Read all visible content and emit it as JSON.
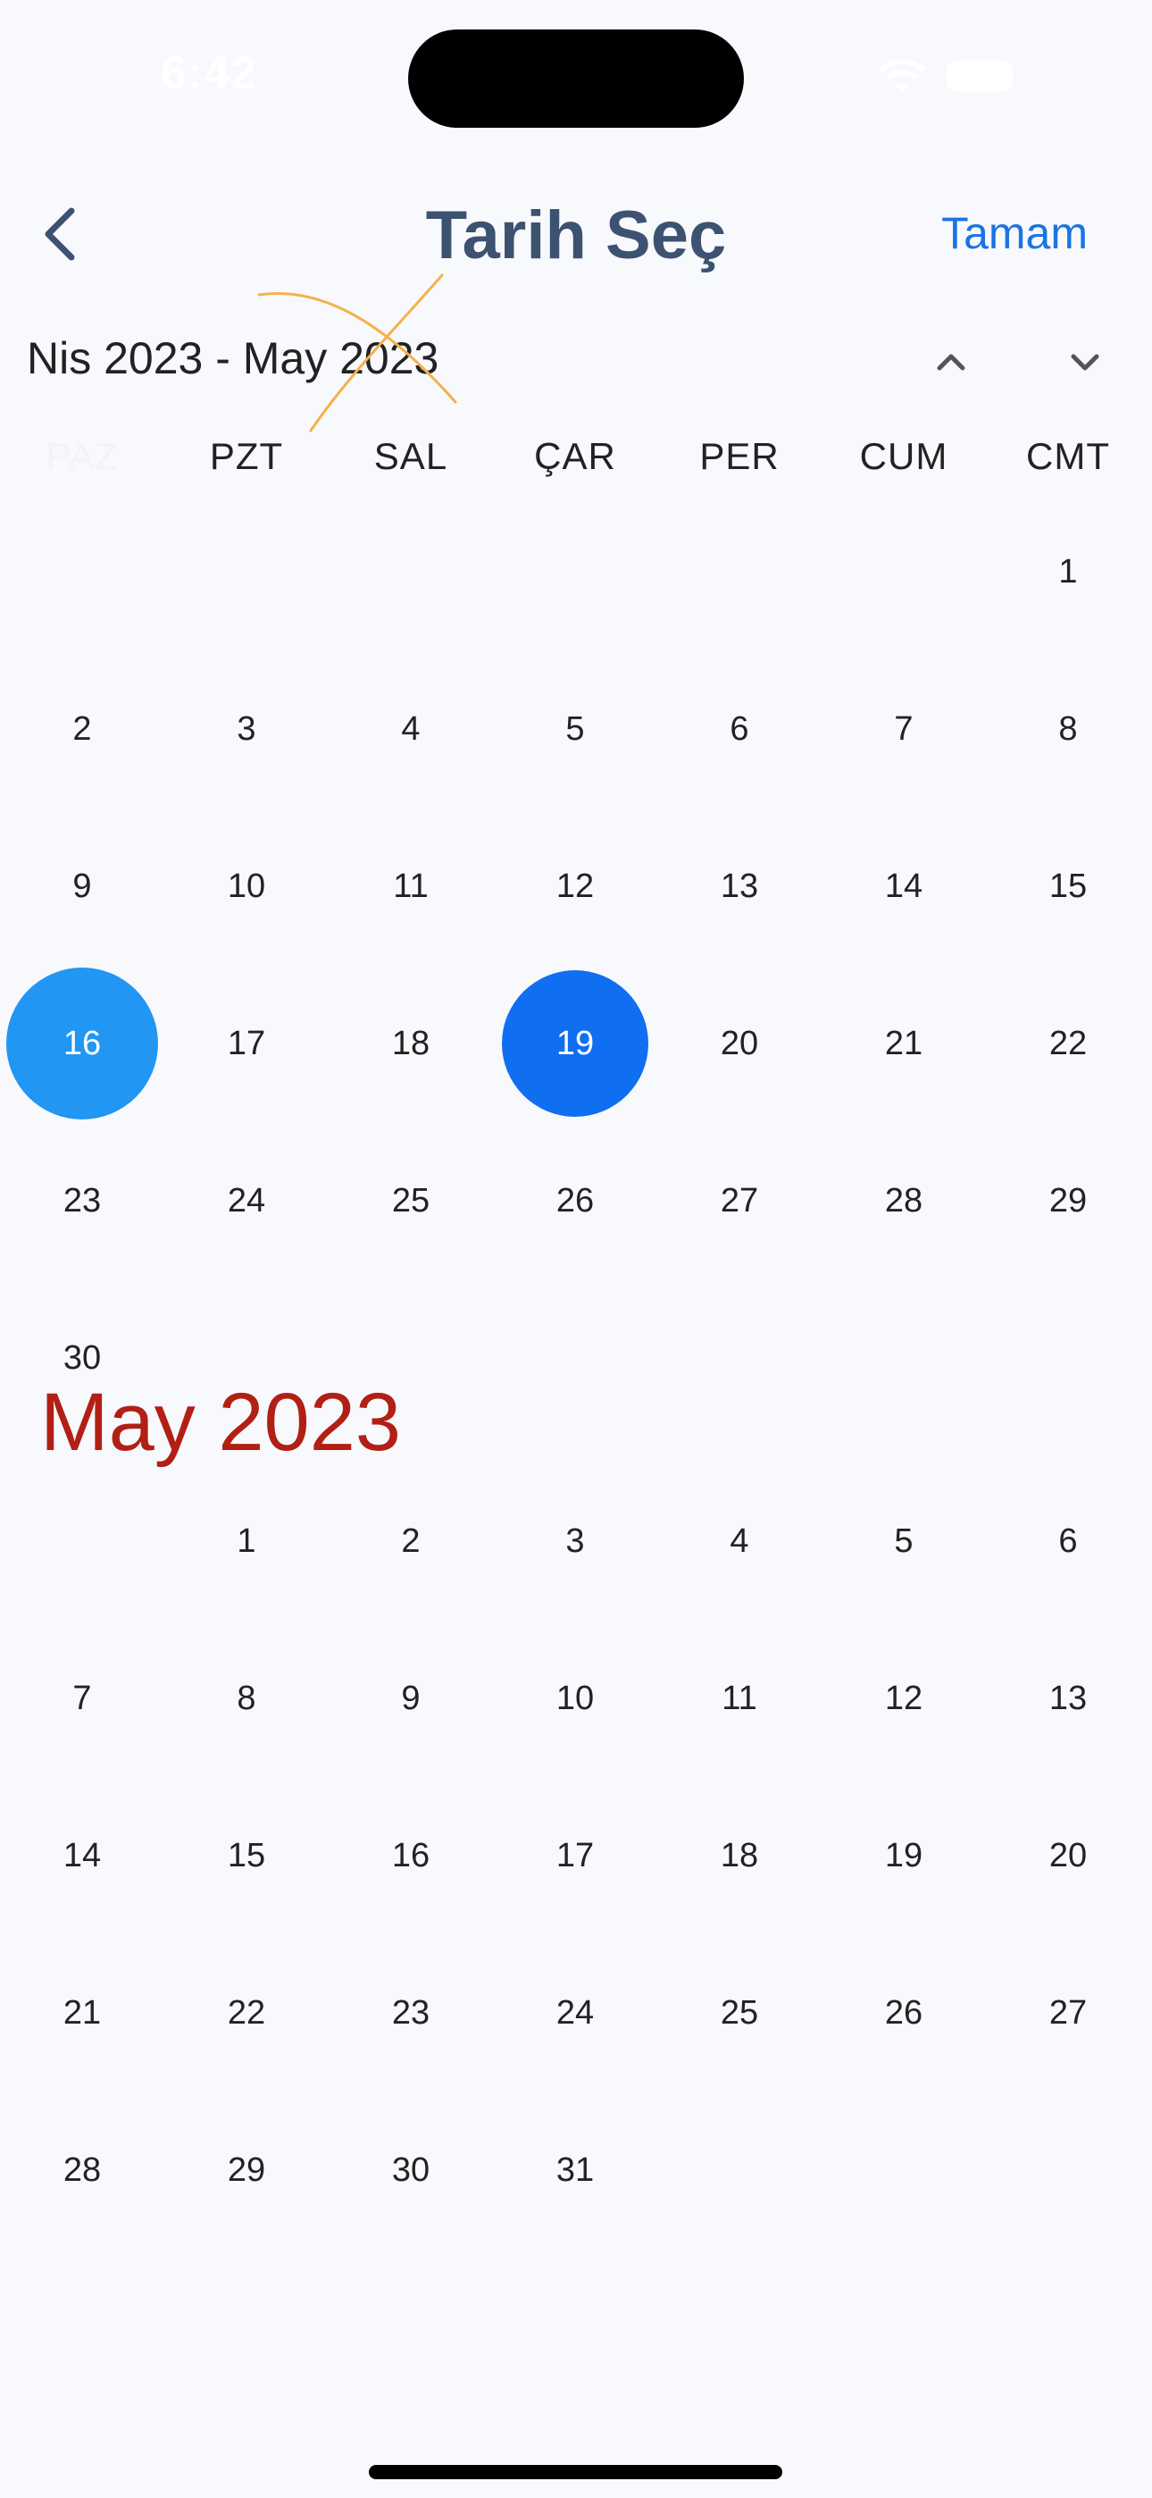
{
  "status_bar": {
    "time": "6:42"
  },
  "nav": {
    "title": "Tarih Seç",
    "done_label": "Tamam",
    "back_icon": "chevron-left-icon"
  },
  "range": {
    "label": "Nis 2023 - May 2023"
  },
  "weekdays": [
    "PAZ",
    "PZT",
    "SAL",
    "ÇAR",
    "PER",
    "CUM",
    "CMT"
  ],
  "april": {
    "weeks": [
      [
        "",
        "",
        "",
        "",
        "",
        "",
        "1"
      ],
      [
        "2",
        "3",
        "4",
        "5",
        "6",
        "7",
        "8"
      ],
      [
        "9",
        "10",
        "11",
        "12",
        "13",
        "14",
        "15"
      ],
      [
        "16",
        "17",
        "18",
        "19",
        "20",
        "21",
        "22"
      ],
      [
        "23",
        "24",
        "25",
        "26",
        "27",
        "28",
        "29"
      ],
      [
        "30",
        "",
        "",
        "",
        "",
        "",
        ""
      ]
    ],
    "selected_start": "16",
    "selected_end": "19"
  },
  "may": {
    "title": "May 2023",
    "weeks": [
      [
        "",
        "1",
        "2",
        "3",
        "4",
        "5",
        "6"
      ],
      [
        "7",
        "8",
        "9",
        "10",
        "11",
        "12",
        "13"
      ],
      [
        "14",
        "15",
        "16",
        "17",
        "18",
        "19",
        "20"
      ],
      [
        "21",
        "22",
        "23",
        "24",
        "25",
        "26",
        "27"
      ],
      [
        "28",
        "29",
        "30",
        "31",
        "",
        "",
        ""
      ]
    ]
  },
  "colors": {
    "accent": "#1b74e4",
    "selected_start": "#2196f3",
    "selected_end": "#0f6ff0",
    "month_title": "#b21f14",
    "title": "#3d5270"
  }
}
